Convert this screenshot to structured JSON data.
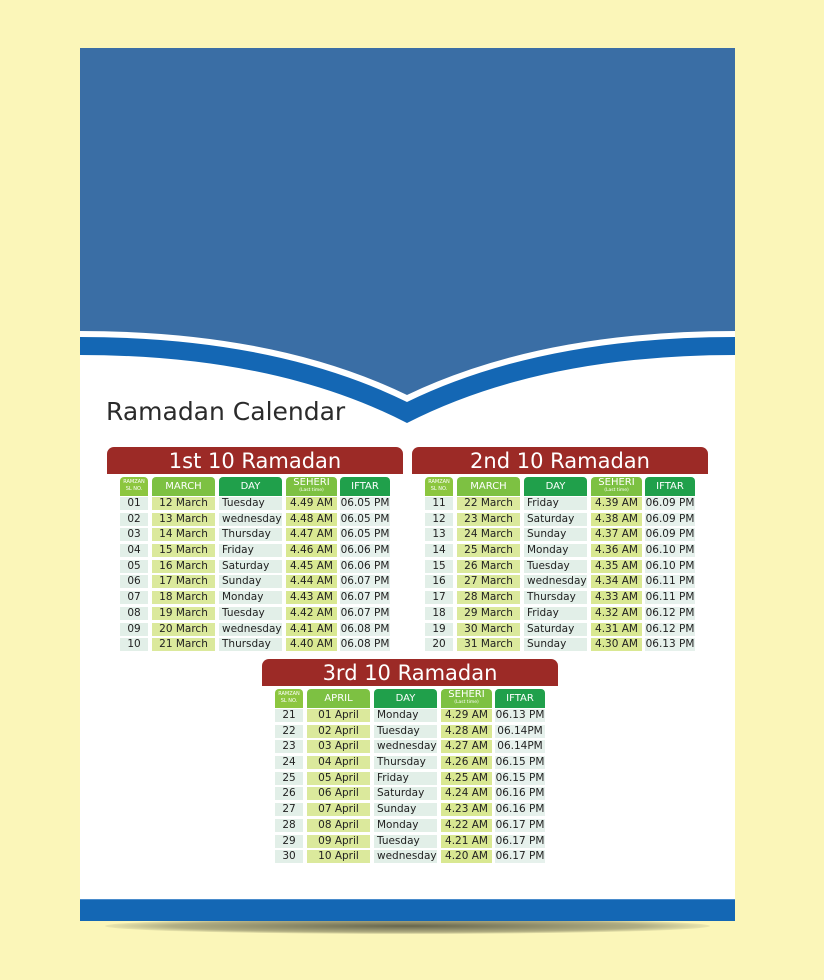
{
  "colors": {
    "background": "#fbf6b9",
    "header_blue": "#3a6ea5",
    "band_blue": "#1467b4",
    "title_bar_red": "#9c2a26",
    "light_green": "#7dc142",
    "dark_green": "#20a04b"
  },
  "title": "Ramadan Calendar",
  "tables": [
    {
      "title": "1st 10 Ramadan",
      "headers": {
        "sl": "RAMZAN SL NO.",
        "month": "MARCH",
        "day": "DAY",
        "seheri": "SEHERI",
        "seheri_note": "(Last time)",
        "iftar": "IFTAR"
      },
      "rows": [
        [
          "01",
          "12 March",
          "Tuesday",
          "4.49 AM",
          "06.05 PM"
        ],
        [
          "02",
          "13 March",
          "wednesday",
          "4.48 AM",
          "06.05 PM"
        ],
        [
          "03",
          "14 March",
          "Thursday",
          "4.47 AM",
          "06.05 PM"
        ],
        [
          "04",
          "15 March",
          "Friday",
          "4.46 AM",
          "06.06 PM"
        ],
        [
          "05",
          "16 March",
          "Saturday",
          "4.45 AM",
          "06.06 PM"
        ],
        [
          "06",
          "17 March",
          "Sunday",
          "4.44 AM",
          "06.07 PM"
        ],
        [
          "07",
          "18 March",
          "Monday",
          "4.43 AM",
          "06.07 PM"
        ],
        [
          "08",
          "19 March",
          "Tuesday",
          "4.42 AM",
          "06.07 PM"
        ],
        [
          "09",
          "20 March",
          "wednesday",
          "4.41 AM",
          "06.08 PM"
        ],
        [
          "10",
          "21 March",
          "Thursday",
          "4.40 AM",
          "06.08 PM"
        ]
      ]
    },
    {
      "title": "2nd 10 Ramadan",
      "headers": {
        "sl": "RAMZAN SL NO.",
        "month": "MARCH",
        "day": "DAY",
        "seheri": "SEHERI",
        "seheri_note": "(Last time)",
        "iftar": "IFTAR"
      },
      "rows": [
        [
          "11",
          "22 March",
          "Friday",
          "4.39 AM",
          "06.09 PM"
        ],
        [
          "12",
          "23 March",
          "Saturday",
          "4.38 AM",
          "06.09 PM"
        ],
        [
          "13",
          "24 March",
          "Sunday",
          "4.37 AM",
          "06.09 PM"
        ],
        [
          "14",
          "25 March",
          "Monday",
          "4.36 AM",
          "06.10 PM"
        ],
        [
          "15",
          "26 March",
          "Tuesday",
          "4.35 AM",
          "06.10 PM"
        ],
        [
          "16",
          "27 March",
          "wednesday",
          "4.34 AM",
          "06.11 PM"
        ],
        [
          "17",
          "28 March",
          "Thursday",
          "4.33 AM",
          "06.11 PM"
        ],
        [
          "18",
          "29 March",
          "Friday",
          "4.32 AM",
          "06.12 PM"
        ],
        [
          "19",
          "30 March",
          "Saturday",
          "4.31 AM",
          "06.12 PM"
        ],
        [
          "20",
          "31 March",
          "Sunday",
          "4.30 AM",
          "06.13 PM"
        ]
      ]
    },
    {
      "title": "3rd 10 Ramadan",
      "headers": {
        "sl": "RAMZAN SL NO.",
        "month": "APRIL",
        "day": "DAY",
        "seheri": "SEHERI",
        "seheri_note": "(Last time)",
        "iftar": "IFTAR"
      },
      "rows": [
        [
          "21",
          "01 April",
          "Monday",
          "4.29 AM",
          "06.13 PM"
        ],
        [
          "22",
          "02 April",
          "Tuesday",
          "4.28 AM",
          "06.14PM"
        ],
        [
          "23",
          "03 April",
          "wednesday",
          "4.27 AM",
          "06.14PM"
        ],
        [
          "24",
          "04 April",
          "Thursday",
          "4.26 AM",
          "06.15 PM"
        ],
        [
          "25",
          "05 April",
          "Friday",
          "4.25 AM",
          "06.15 PM"
        ],
        [
          "26",
          "06 April",
          "Saturday",
          "4.24 AM",
          "06.16 PM"
        ],
        [
          "27",
          "07 April",
          "Sunday",
          "4.23 AM",
          "06.16 PM"
        ],
        [
          "28",
          "08 April",
          "Monday",
          "4.22 AM",
          "06.17 PM"
        ],
        [
          "29",
          "09 April",
          "Tuesday",
          "4.21 AM",
          "06.17 PM"
        ],
        [
          "30",
          "10 April",
          "wednesday",
          "4.20 AM",
          "06.17 PM"
        ]
      ]
    }
  ]
}
